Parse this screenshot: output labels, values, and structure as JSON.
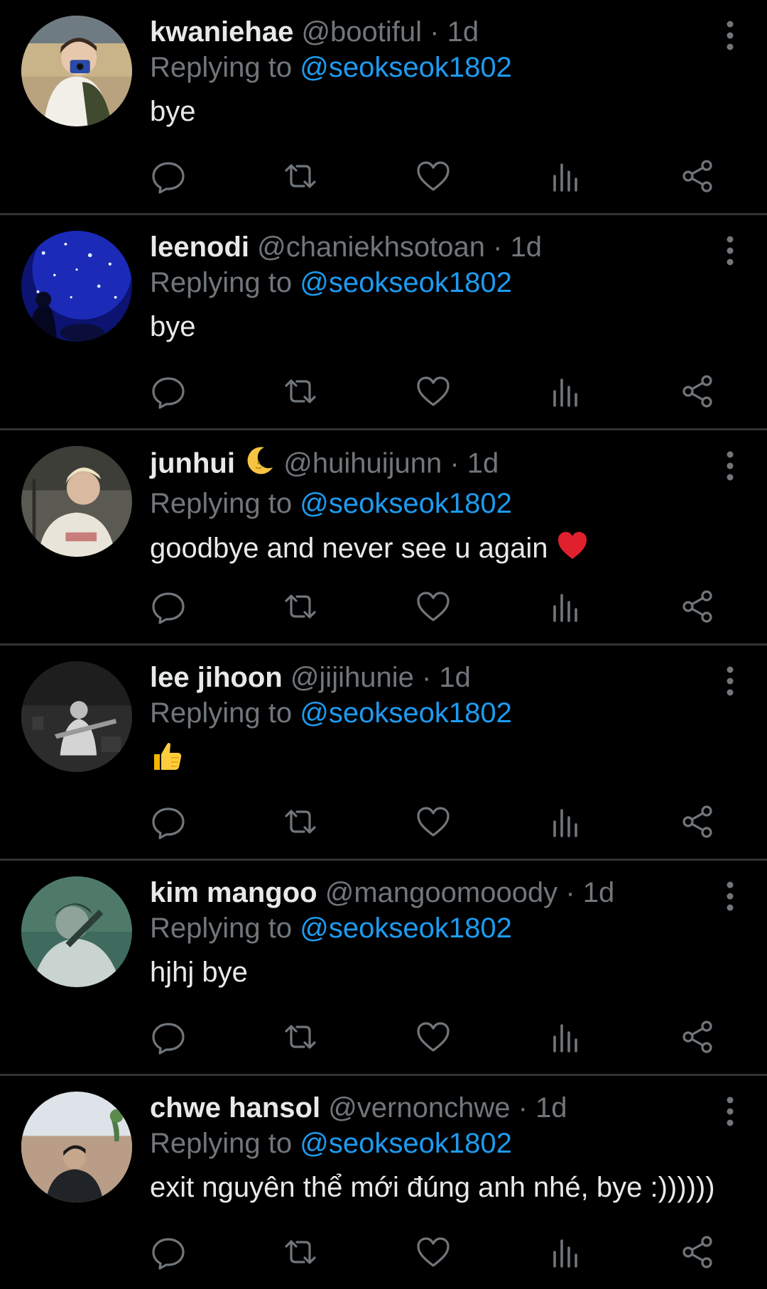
{
  "icons": {
    "reply": "reply-bubble-icon",
    "retweet": "retweet-icon",
    "like": "heart-icon",
    "views": "bar-chart-icon",
    "share": "share-icon",
    "more": "more-vertical-icon"
  },
  "colors": {
    "background": "#000000",
    "primary_text": "#e7e9ea",
    "secondary_text": "#71767b",
    "link": "#1d9bf0",
    "divider": "#2f3336"
  },
  "tweets": [
    {
      "name": "kwaniehae",
      "handle": "@bootiful",
      "dot": "·",
      "time": "1d",
      "replying_prefix": "Replying to",
      "replying_to": "@seokseok1802",
      "text": "bye"
    },
    {
      "name": "leenodi",
      "handle": "@chaniekhsotoan",
      "dot": "·",
      "time": "1d",
      "replying_prefix": "Replying to",
      "replying_to": "@seokseok1802",
      "text": "bye"
    },
    {
      "name": "junhui",
      "name_emoji": "moon-emoji",
      "handle": "@huihuijunn",
      "dot": "·",
      "time": "1d",
      "replying_prefix": "Replying to",
      "replying_to": "@seokseok1802",
      "text": "goodbye and never see u again",
      "text_emoji": "red-heart-emoji"
    },
    {
      "name": "lee jihoon",
      "handle": "@jijihunie",
      "dot": "·",
      "time": "1d",
      "replying_prefix": "Replying to",
      "replying_to": "@seokseok1802",
      "text": "",
      "text_emoji": "thumbs-up-emoji"
    },
    {
      "name": "kim mangoo",
      "handle": "@mangoomooody",
      "dot": "·",
      "time": "1d",
      "replying_prefix": "Replying to",
      "replying_to": "@seokseok1802",
      "text": "hjhj bye"
    },
    {
      "name": "chwe hansol",
      "handle": "@vernonchwe",
      "dot": "·",
      "time": "1d",
      "replying_prefix": "Replying to",
      "replying_to": "@seokseok1802",
      "text": "exit nguyên thể mới đúng anh nhé, bye :))))))"
    }
  ]
}
